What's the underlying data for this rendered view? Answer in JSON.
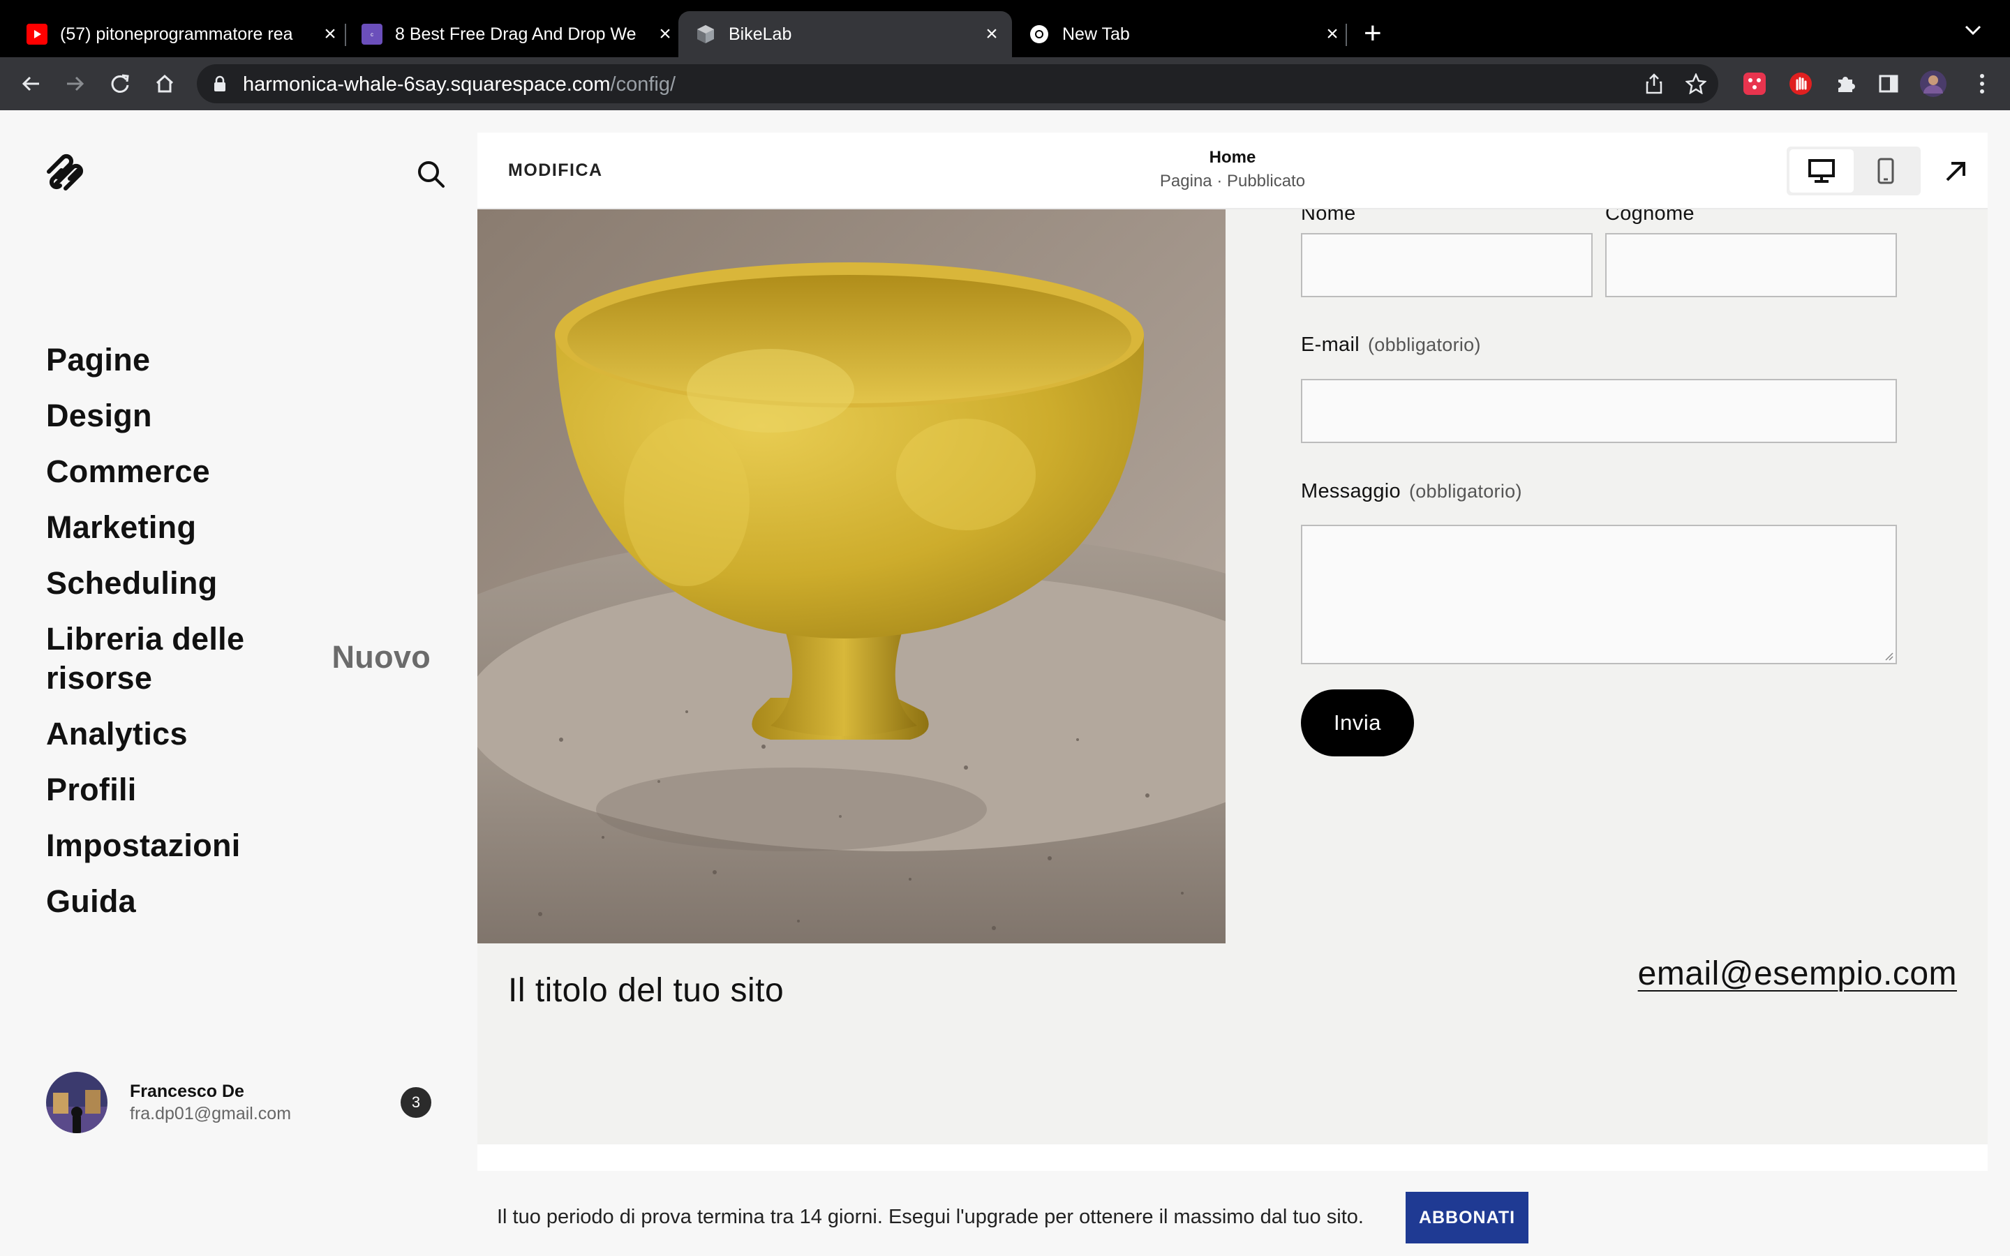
{
  "browser": {
    "tabs": [
      {
        "title": "(57) pitoneprogrammatore rea",
        "favicon": "youtube-icon"
      },
      {
        "title": "8 Best Free Drag And Drop We",
        "favicon": "colorlib-icon"
      },
      {
        "title": "BikeLab",
        "favicon": "squarespace-cube-icon"
      },
      {
        "title": "New Tab",
        "favicon": "chrome-icon"
      }
    ],
    "url_host": "harmonica-whale-6say.squarespace.com",
    "url_path": "/config/"
  },
  "sidebar": {
    "items": [
      {
        "label": "Pagine"
      },
      {
        "label": "Design"
      },
      {
        "label": "Commerce"
      },
      {
        "label": "Marketing"
      },
      {
        "label": "Scheduling"
      },
      {
        "label": "Libreria delle risorse",
        "line1": "Libreria delle",
        "line2": "risorse",
        "badge": "Nuovo"
      },
      {
        "label": "Analytics"
      },
      {
        "label": "Profili"
      },
      {
        "label": "Impostazioni"
      },
      {
        "label": "Guida"
      }
    ],
    "user": {
      "name": "Francesco De",
      "email": "fra.dp01@gmail.com",
      "notifications": "3"
    }
  },
  "editor": {
    "edit_label": "MODIFICA",
    "page_title": "Home",
    "page_status": "Pagina · Pubblicato"
  },
  "form": {
    "first_name_label": "Nome",
    "last_name_label": "Cognome",
    "email_label": "E-mail",
    "email_required": "(obbligatorio)",
    "message_label": "Messaggio",
    "message_required": "(obbligatorio)",
    "submit_label": "Invia"
  },
  "site": {
    "title": "Il titolo del tuo sito",
    "email": "email@esempio.com"
  },
  "trial": {
    "message": "Il tuo periodo di prova termina tra 14 giorni. Esegui l'upgrade per ottenere il massimo dal tuo sito.",
    "cta": "ABBONATI"
  },
  "colors": {
    "cta_blue": "#1f3a93",
    "submit_black": "#000000",
    "bowl_yellow": "#d4b233"
  }
}
